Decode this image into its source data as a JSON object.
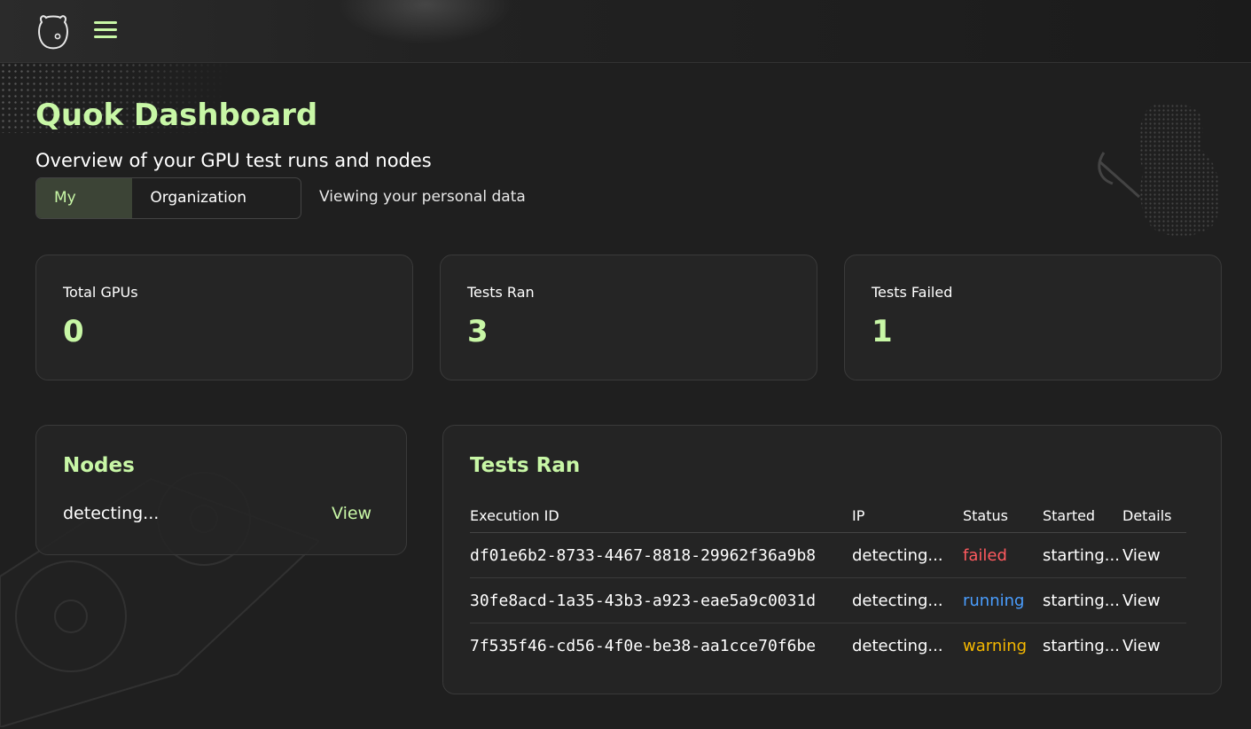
{
  "header": {
    "logo_icon": "quokka-logo-icon",
    "menu_icon": "hamburger-menu-icon"
  },
  "page": {
    "title": "Quok Dashboard",
    "subtitle": "Overview of your GPU test runs and nodes",
    "view_toggle": {
      "my_view": "My View",
      "organization_view": "Organization View",
      "selected": "My View"
    },
    "view_note": "Viewing your personal data"
  },
  "stats": [
    {
      "label": "Total GPUs",
      "value": "0"
    },
    {
      "label": "Tests Ran",
      "value": "3"
    },
    {
      "label": "Tests Failed",
      "value": "1"
    }
  ],
  "nodes_panel": {
    "title": "Nodes",
    "status": "detecting...",
    "link": "View"
  },
  "tests_panel": {
    "title": "Tests Ran",
    "columns": [
      "Execution ID",
      "IP",
      "Status",
      "Started",
      "Details"
    ],
    "rows": [
      {
        "id": "df01e6b2-8733-4467-8818-29962f36a9b8",
        "ip": "detecting...",
        "status": "failed",
        "status_color": "#ff5a5f",
        "started": "starting...",
        "details": "View"
      },
      {
        "id": "30fe8acd-1a35-43b3-a923-eae5a9c0031d",
        "ip": "detecting...",
        "status": "running",
        "status_color": "#4a9eff",
        "started": "starting...",
        "details": "View"
      },
      {
        "id": "7f535f46-cd56-4f0e-be38-aa1cce70f6be",
        "ip": "detecting...",
        "status": "warning",
        "status_color": "#f5b800",
        "started": "starting...",
        "details": "View"
      }
    ]
  },
  "colors": {
    "accent": "#c8f7a6",
    "background": "#1f1f1f",
    "card": "#252525"
  }
}
